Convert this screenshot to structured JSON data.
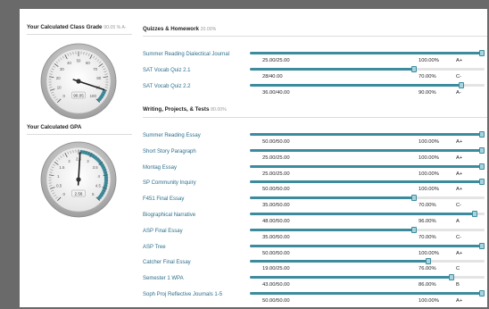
{
  "class_grade": {
    "title": "Your Calculated Class Grade",
    "sub": "90.05 % A-",
    "gauge_value": "90.05",
    "gauge_percent": 90.05,
    "ticks": [
      "0",
      "10",
      "20",
      "30",
      "40",
      "50",
      "60",
      "70",
      "80",
      "90",
      "100"
    ]
  },
  "gpa": {
    "title": "Your Calculated GPA",
    "gauge_value": "2.56",
    "gauge_number": 2.56,
    "ticks": [
      "0",
      "0.5",
      "1",
      "1.5",
      "2",
      "2.5",
      "3",
      "3.5",
      "4",
      "4.5",
      "5"
    ]
  },
  "sections": [
    {
      "title": "Quizzes & Homework",
      "weight": "20.00%",
      "items": [
        {
          "name": "Summer Reading Dialectical Journal",
          "score": "25.00/25.00",
          "pct": "100.00%",
          "grade": "A+",
          "fraction": 1.0
        },
        {
          "name": "SAT Vocab Quiz 2.1",
          "score": "28/40.00",
          "pct": "70.00%",
          "grade": "C-",
          "fraction": 0.7
        },
        {
          "name": "SAT Vocab Quiz 2.2",
          "score": "36.00/40.00",
          "pct": "90.00%",
          "grade": "A-",
          "fraction": 0.9
        }
      ]
    },
    {
      "title": "Writing, Projects, & Tests",
      "weight": "80.00%",
      "items": [
        {
          "name": "Summer Reading Essay",
          "score": "50.00/50.00",
          "pct": "100.00%",
          "grade": "A+",
          "fraction": 1.0
        },
        {
          "name": "Short Story Paragraph",
          "score": "25.00/25.00",
          "pct": "100.00%",
          "grade": "A+",
          "fraction": 1.0
        },
        {
          "name": "Montag Essay",
          "score": "25.00/25.00",
          "pct": "100.00%",
          "grade": "A+",
          "fraction": 1.0
        },
        {
          "name": "SP Community Inquiry",
          "score": "50.00/50.00",
          "pct": "100.00%",
          "grade": "A+",
          "fraction": 1.0
        },
        {
          "name": "F451 Final Essay",
          "score": "35.00/50.00",
          "pct": "70.00%",
          "grade": "C-",
          "fraction": 0.7
        },
        {
          "name": "Biographical Narrative",
          "score": "48.00/50.00",
          "pct": "96.00%",
          "grade": "A",
          "fraction": 0.96
        },
        {
          "name": "ASP Final Essay",
          "score": "35.00/50.00",
          "pct": "70.00%",
          "grade": "C-",
          "fraction": 0.7
        },
        {
          "name": "ASP Tree",
          "score": "50.00/50.00",
          "pct": "100.00%",
          "grade": "A+",
          "fraction": 1.0
        },
        {
          "name": "Catcher Final Essay",
          "score": "19.00/25.00",
          "pct": "76.00%",
          "grade": "C",
          "fraction": 0.76
        },
        {
          "name": "Semester 1 WPA",
          "score": "43.00/50.00",
          "pct": "86.00%",
          "grade": "B",
          "fraction": 0.86
        },
        {
          "name": "Soph Proj Reflective Journals 1-5",
          "score": "50.00/50.00",
          "pct": "100.00%",
          "grade": "A+",
          "fraction": 1.0
        }
      ]
    }
  ],
  "colors": {
    "accent": "#3d8c9d",
    "link": "#2d6f8a",
    "track": "#e4e4e4"
  }
}
